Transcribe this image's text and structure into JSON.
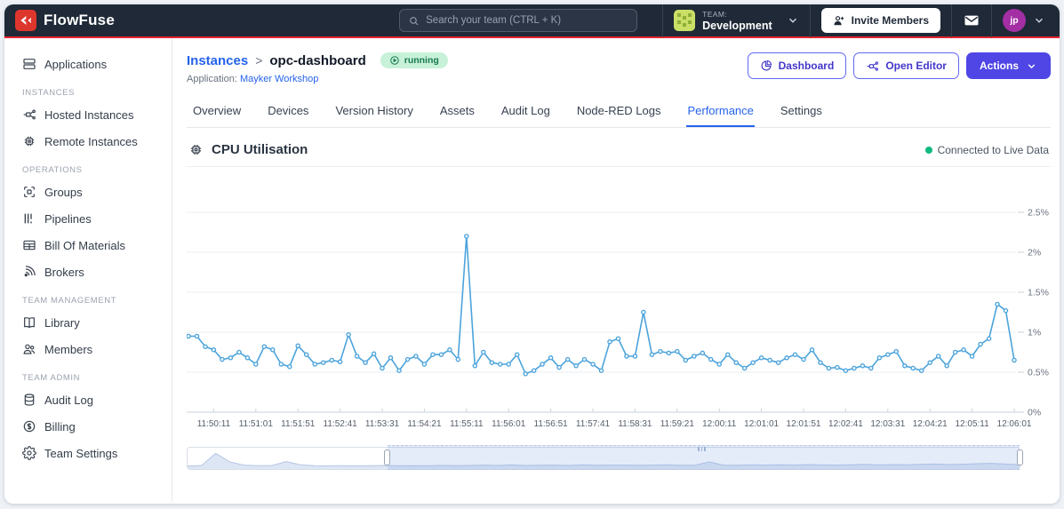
{
  "navbar": {
    "brand": "FlowFuse",
    "search_placeholder": "Search your team (CTRL + K)",
    "team_label": "TEAM:",
    "team_name": "Development",
    "invite_button": "Invite Members",
    "avatar_initials": "jp"
  },
  "sidebar": {
    "sections": [
      {
        "header": "",
        "items": [
          {
            "label": "Applications"
          }
        ]
      },
      {
        "header": "INSTANCES",
        "items": [
          {
            "label": "Hosted Instances"
          },
          {
            "label": "Remote Instances"
          }
        ]
      },
      {
        "header": "OPERATIONS",
        "items": [
          {
            "label": "Groups"
          },
          {
            "label": "Pipelines"
          },
          {
            "label": "Bill Of Materials"
          },
          {
            "label": "Brokers"
          }
        ]
      },
      {
        "header": "TEAM MANAGEMENT",
        "items": [
          {
            "label": "Library"
          },
          {
            "label": "Members"
          }
        ]
      },
      {
        "header": "TEAM ADMIN",
        "items": [
          {
            "label": "Audit Log"
          },
          {
            "label": "Billing"
          },
          {
            "label": "Team Settings"
          }
        ]
      }
    ]
  },
  "header": {
    "breadcrumb_root": "Instances",
    "breadcrumb_separator": ">",
    "instance_name": "opc-dashboard",
    "status_badge": "running",
    "application_label": "Application:",
    "application_name": "Mayker Workshop",
    "dashboard_button": "Dashboard",
    "open_editor_button": "Open Editor",
    "actions_button": "Actions"
  },
  "tabs": {
    "items": [
      "Overview",
      "Devices",
      "Version History",
      "Assets",
      "Audit Log",
      "Node-RED Logs",
      "Performance",
      "Settings"
    ],
    "active": "Performance"
  },
  "performance": {
    "live_status": "Connected to Live Data"
  },
  "icons": {
    "brand": "double-chevron-left",
    "search": "magnifier",
    "mail": "envelope",
    "invite": "user-plus",
    "dashboard": "pie-chart",
    "open_editor": "node-graph",
    "running": "play-circle",
    "chart": "cpu-chip"
  },
  "colors": {
    "navbar_bg": "#1f2937",
    "brand_red": "#dd362d",
    "accent_red_line": "#e0242f",
    "indigo": "#4f46e5",
    "tab_active": "#2563eb",
    "link": "#2563eb",
    "running_bg": "#c7f1d8",
    "running_text": "#177a50",
    "live_dot": "#10b981",
    "chart_line": "#4ba3db"
  },
  "chart_data": {
    "type": "line",
    "title": "CPU Utilisation",
    "unit": "%",
    "color": "#4ba3db",
    "grid": true,
    "legend": false,
    "ylim": [
      0,
      3.0
    ],
    "y_ticks": [
      2.5,
      2,
      1.5,
      1,
      0.5,
      0
    ],
    "y_tick_side": "right",
    "x_tick_labels": [
      "11:50:11",
      "11:51:01",
      "11:51:51",
      "11:52:41",
      "11:53:31",
      "11:54:21",
      "11:55:11",
      "11:56:01",
      "11:56:51",
      "11:57:41",
      "11:58:31",
      "11:59:21",
      "12:00:11",
      "12:01:01",
      "12:01:51",
      "12:02:41",
      "12:03:31",
      "12:04:21",
      "12:05:11",
      "12:06:01"
    ],
    "x_tick_start_index": 3,
    "x_tick_every": 5,
    "sample_interval_seconds": 10,
    "values": [
      0.95,
      0.95,
      0.82,
      0.78,
      0.66,
      0.68,
      0.75,
      0.68,
      0.6,
      0.82,
      0.78,
      0.6,
      0.57,
      0.83,
      0.72,
      0.6,
      0.62,
      0.65,
      0.63,
      0.97,
      0.7,
      0.62,
      0.73,
      0.55,
      0.68,
      0.52,
      0.66,
      0.7,
      0.6,
      0.72,
      0.72,
      0.78,
      0.66,
      2.2,
      0.58,
      0.75,
      0.62,
      0.6,
      0.6,
      0.72,
      0.48,
      0.52,
      0.6,
      0.68,
      0.56,
      0.66,
      0.58,
      0.66,
      0.6,
      0.52,
      0.88,
      0.92,
      0.7,
      0.7,
      1.25,
      0.72,
      0.76,
      0.74,
      0.76,
      0.65,
      0.7,
      0.74,
      0.66,
      0.6,
      0.72,
      0.62,
      0.55,
      0.62,
      0.68,
      0.65,
      0.62,
      0.68,
      0.72,
      0.66,
      0.78,
      0.62,
      0.55,
      0.56,
      0.52,
      0.55,
      0.58,
      0.55,
      0.68,
      0.72,
      0.76,
      0.58,
      0.55,
      0.52,
      0.62,
      0.7,
      0.58,
      0.75,
      0.78,
      0.7,
      0.85,
      0.92,
      1.35,
      1.27,
      0.65
    ],
    "brush": {
      "selection_start_frac": 0.24,
      "selection_end_frac": 1.0,
      "values": [
        0.06,
        0.1,
        0.78,
        0.3,
        0.12,
        0.09,
        0.1,
        0.32,
        0.14,
        0.09,
        0.08,
        0.09,
        0.08,
        0.09,
        0.1,
        0.08,
        0.09,
        0.08,
        0.1,
        0.09,
        0.1,
        0.12,
        0.1,
        0.13,
        0.1,
        0.11,
        0.12,
        0.1,
        0.13,
        0.11,
        0.12,
        0.12,
        0.11,
        0.12,
        0.13,
        0.11,
        0.12,
        0.3,
        0.12,
        0.11,
        0.13,
        0.12,
        0.14,
        0.12,
        0.15,
        0.13,
        0.12,
        0.14,
        0.16,
        0.13,
        0.15,
        0.14,
        0.16,
        0.18,
        0.15,
        0.17,
        0.2,
        0.22,
        0.18,
        0.14
      ]
    }
  }
}
